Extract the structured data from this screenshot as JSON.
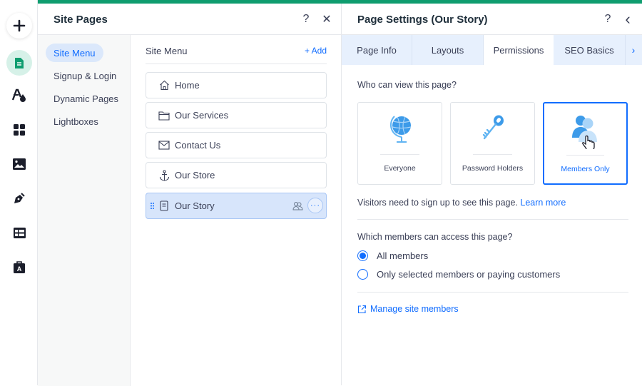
{
  "toolbar": {
    "items": [
      {
        "name": "add",
        "icon": "plus-icon"
      },
      {
        "name": "pages",
        "icon": "page-icon",
        "active": true
      },
      {
        "name": "design",
        "icon": "theme-icon"
      },
      {
        "name": "apps",
        "icon": "apps-grid-icon"
      },
      {
        "name": "media",
        "icon": "image-icon"
      },
      {
        "name": "blog",
        "icon": "pen-icon"
      },
      {
        "name": "cms",
        "icon": "table-icon"
      },
      {
        "name": "business",
        "icon": "briefcase-icon"
      }
    ]
  },
  "site_pages": {
    "title": "Site Pages",
    "help": "?",
    "close": "✕",
    "nav": [
      {
        "label": "Site Menu",
        "active": true
      },
      {
        "label": "Signup & Login"
      },
      {
        "label": "Dynamic Pages"
      },
      {
        "label": "Lightboxes"
      }
    ],
    "list_header": "Site Menu",
    "add_label": "+ Add",
    "pages": [
      {
        "label": "Home",
        "icon": "home-icon"
      },
      {
        "label": "Our Services",
        "icon": "folder-icon"
      },
      {
        "label": "Contact Us",
        "icon": "mail-icon"
      },
      {
        "label": "Our Store",
        "icon": "anchor-icon"
      },
      {
        "label": "Our Story",
        "icon": "page-icon",
        "selected": true
      }
    ],
    "more_label": "···"
  },
  "page_settings": {
    "title": "Page Settings (Our Story)",
    "help": "?",
    "back": "‹",
    "tabs": [
      {
        "label": "Page Info"
      },
      {
        "label": "Layouts"
      },
      {
        "label": "Permissions",
        "active": true
      },
      {
        "label": "SEO Basics"
      }
    ],
    "tabs_more": "›",
    "who_label": "Who can view this page?",
    "options": [
      {
        "label": "Everyone",
        "icon": "globe-icon"
      },
      {
        "label": "Password Holders",
        "icon": "key-icon"
      },
      {
        "label": "Members Only",
        "icon": "members-icon",
        "selected": true
      }
    ],
    "hint": "Visitors need to sign up to see this page.",
    "learn_more": "Learn more",
    "which_label": "Which members can access this page?",
    "radios": [
      {
        "label": "All members",
        "checked": true
      },
      {
        "label": "Only selected members or paying customers",
        "checked": false
      }
    ],
    "manage_link": "Manage site members"
  },
  "colors": {
    "accent": "#116dff",
    "brand_green": "#0f9d6f",
    "selected_row": "#d7e5fb"
  }
}
